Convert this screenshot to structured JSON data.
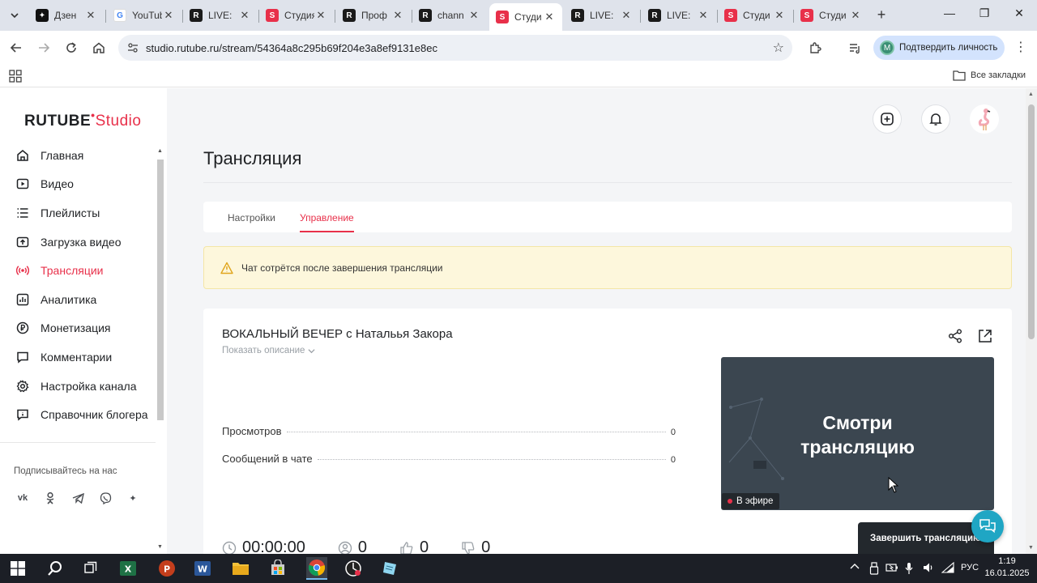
{
  "browser": {
    "tabs": [
      {
        "title": "Дзен",
        "favicon": "dzen-icon"
      },
      {
        "title": "YouTube",
        "favicon": "google-icon"
      },
      {
        "title": "LIVE:",
        "favicon": "rutube-icon"
      },
      {
        "title": "Студия",
        "favicon": "rutube-studio-icon"
      },
      {
        "title": "Проф",
        "favicon": "rutube-icon"
      },
      {
        "title": "chann",
        "favicon": "rutube-icon"
      },
      {
        "title": "Студи",
        "favicon": "rutube-studio-icon",
        "active": true
      },
      {
        "title": "LIVE:",
        "favicon": "rutube-icon"
      },
      {
        "title": "LIVE:",
        "favicon": "rutube-icon"
      },
      {
        "title": "Студи",
        "favicon": "rutube-studio-icon"
      },
      {
        "title": "Студи",
        "favicon": "rutube-studio-icon"
      }
    ],
    "url": "studio.rutube.ru/stream/54364a8c295b69f204e3a8ef9131e8ec",
    "verify_label": "Подтвердить личность",
    "verify_avatar": "M",
    "all_bookmarks": "Все закладки"
  },
  "sidebar": {
    "logo_main": "RUTUBE",
    "logo_studio": "Studio",
    "items": [
      {
        "label": "Главная",
        "icon": "home-icon"
      },
      {
        "label": "Видео",
        "icon": "video-icon"
      },
      {
        "label": "Плейлисты",
        "icon": "playlist-icon"
      },
      {
        "label": "Загрузка видео",
        "icon": "upload-icon"
      },
      {
        "label": "Трансляции",
        "icon": "broadcast-icon",
        "active": true
      },
      {
        "label": "Аналитика",
        "icon": "analytics-icon"
      },
      {
        "label": "Монетизация",
        "icon": "monetization-icon"
      },
      {
        "label": "Комментарии",
        "icon": "comments-icon"
      },
      {
        "label": "Настройка канала",
        "icon": "gear-icon"
      },
      {
        "label": "Справочник блогера",
        "icon": "info-icon"
      }
    ],
    "subscribe_label": "Подписывайтесь на нас",
    "socials": [
      "vk",
      "ok",
      "telegram",
      "viber",
      "more"
    ]
  },
  "main": {
    "title": "Трансляция",
    "tabs": [
      {
        "label": "Настройки"
      },
      {
        "label": "Управление",
        "active": true
      }
    ],
    "warning": "Чат сотрётся после завершения трансляции",
    "stream": {
      "title": "ВОКАЛЬНЫЙ ВЕЧЕР с Натальья Закора",
      "show_description": "Показать описание",
      "stats": [
        {
          "label": "Просмотров",
          "value": "0"
        },
        {
          "label": "Сообщений в чате",
          "value": "0"
        }
      ],
      "preview_line1": "Смотри",
      "preview_line2": "трансляцию",
      "live_badge": "В эфире",
      "timer": "00:00:00",
      "viewers": "0",
      "likes": "0",
      "dislikes": "0",
      "end_button": "Завершить трансляцию"
    }
  },
  "taskbar": {
    "lang": "РУС",
    "time": "1:19",
    "date": "16.01.2025"
  },
  "colors": {
    "accent": "#e8304a",
    "warning_bg": "#fdf7dc",
    "preview_bg": "#3b4650",
    "fab": "#1fa6c4"
  }
}
